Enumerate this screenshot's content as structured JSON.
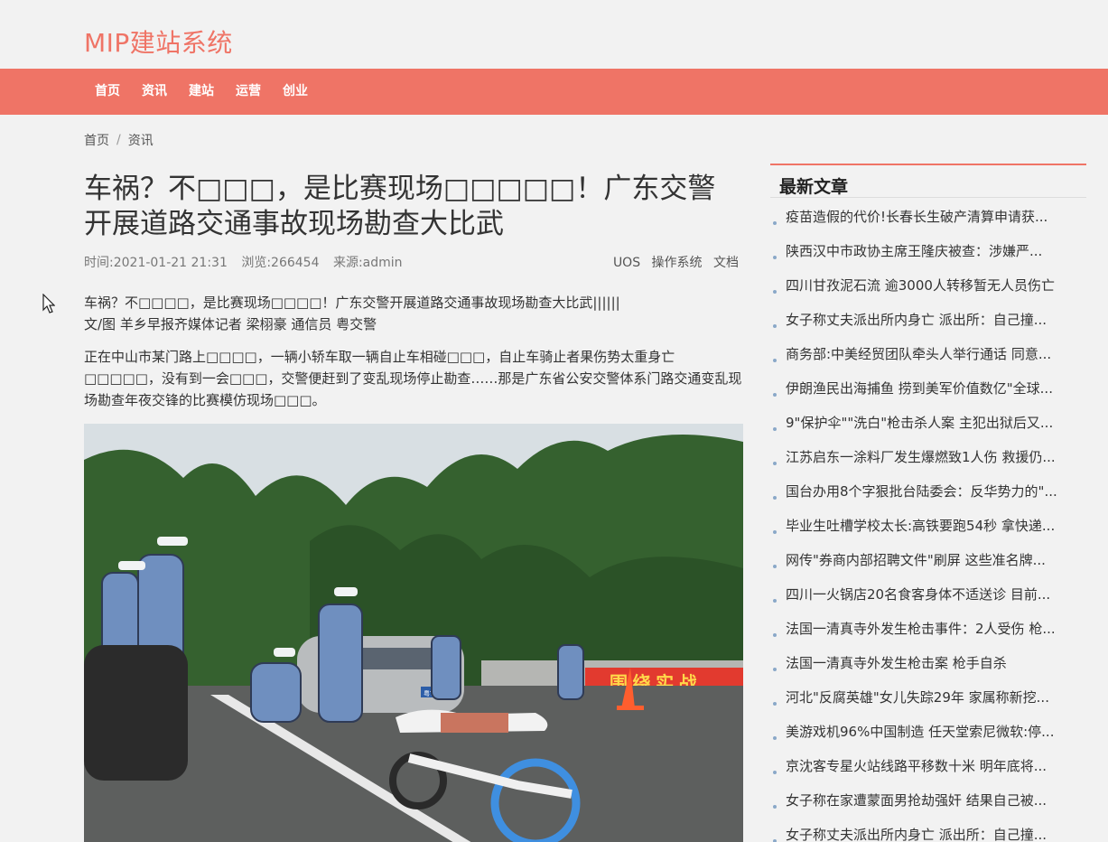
{
  "header": {
    "logo": "MIP建站系统"
  },
  "nav": {
    "items": [
      "首页",
      "资讯",
      "建站",
      "运营",
      "创业"
    ]
  },
  "breadcrumb": {
    "home": "首页",
    "separator": "/",
    "current": "资讯"
  },
  "article": {
    "title": "车祸？不□□□，是比赛现场□□□□□！广东交警开展道路交通事故现场勘查大比武",
    "time": "时间:2021-01-21 21:31",
    "views": "浏览:266454",
    "source": "来源:admin",
    "tags": [
      "UOS",
      "操作系统",
      "文档"
    ],
    "intro_line1": "车祸？不□□□□，是比赛现场□□□□！广东交警开展道路交通事故现场勘查大比武||||||",
    "intro_line2": "文/图 羊乡早报齐媒体记者 梁栩豪 通信员 粤交警",
    "body": "正在中山市某门路上□□□□，一辆小轿车取一辆自止车相碰□□□，自止车骑止者果伤势太重身亡□□□□□，没有到一会□□□，交警便赶到了变乱现场停止勘查……那是广东省公安交警体系门路交通变乱现场勘查年夜交锋的比赛模仿现场□□□。",
    "banner_text": "围 绕 实 战",
    "plate": "粤T·5087"
  },
  "sidebar": {
    "title": "最新文章",
    "items": [
      "疫苗造假的代价!长春长生破产清算申请获...",
      "陕西汉中市政协主席王隆庆被查：涉嫌严...",
      "四川甘孜泥石流 逾3000人转移暂无人员伤亡",
      "女子称丈夫派出所内身亡 派出所：自己撞...",
      "商务部:中美经贸团队牵头人举行通话 同意...",
      "伊朗渔民出海捕鱼 捞到美军价值数亿\"全球...",
      "9\"保护伞\"\"洗白\"枪击杀人案 主犯出狱后又...",
      "江苏启东一涂料厂发生爆燃致1人伤 救援仍...",
      "国台办用8个字狠批台陆委会：反华势力的\"...",
      "毕业生吐槽学校太长:高铁要跑54秒 拿快递...",
      "网传\"券商内部招聘文件\"刷屏 这些准名牌...",
      "四川一火锅店20名食客身体不适送诊 目前...",
      "法国一清真寺外发生枪击事件：2人受伤 枪...",
      "法国一清真寺外发生枪击案 枪手自杀",
      "河北\"反腐英雄\"女儿失踪29年 家属称新挖...",
      "美游戏机96%中国制造 任天堂索尼微软:停...",
      "京沈客专星火站线路平移数十米 明年底将...",
      "女子称在家遭蒙面男抢劫强奸 结果自己被...",
      "女子称丈夫派出所内身亡 派出所：自己撞..."
    ]
  },
  "colors": {
    "accent": "#ef7466",
    "background": "#f2f2f2"
  }
}
